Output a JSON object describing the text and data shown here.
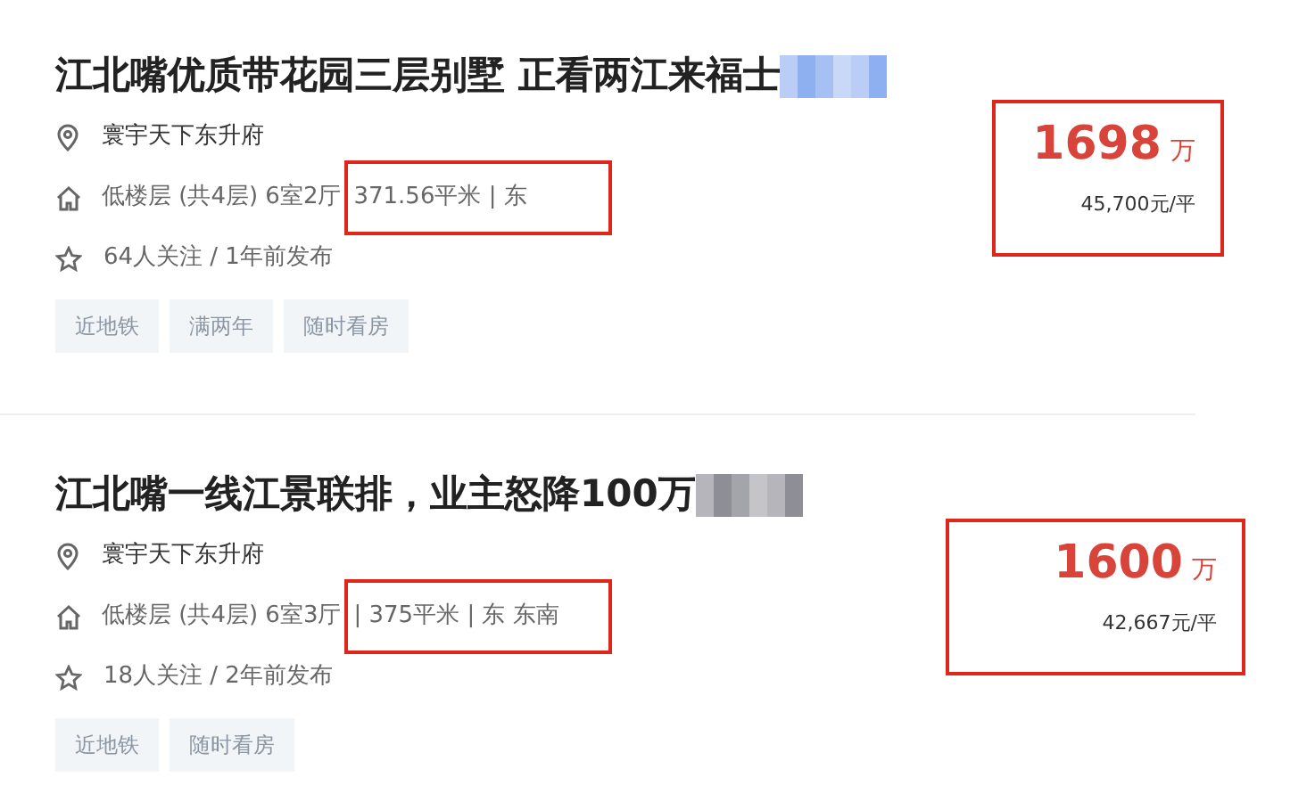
{
  "listings": [
    {
      "title": "江北嘴优质带花园三层别墅 正看两江来福士",
      "title_blurred": true,
      "community": "寰宇天下东升府",
      "layout": "低楼层 (共4层) 6室2厅",
      "area": "371.56平米 | 东",
      "follow": "64人关注 / 1年前发布",
      "tags": [
        "近地铁",
        "满两年",
        "随时看房"
      ],
      "price": "1698",
      "price_unit": "万",
      "unit_price": "45,700元/平"
    },
    {
      "title": "江北嘴一线江景联排，业主怒降100万",
      "title_blurred": true,
      "community": "寰宇天下东升府",
      "layout": "低楼层 (共4层) 6室3厅",
      "area": "| 375平米 | 东 东南",
      "follow": "18人关注 / 2年前发布",
      "tags": [
        "近地铁",
        "随时看房"
      ],
      "price": "1600",
      "price_unit": "万",
      "unit_price": "42,667元/平"
    }
  ]
}
